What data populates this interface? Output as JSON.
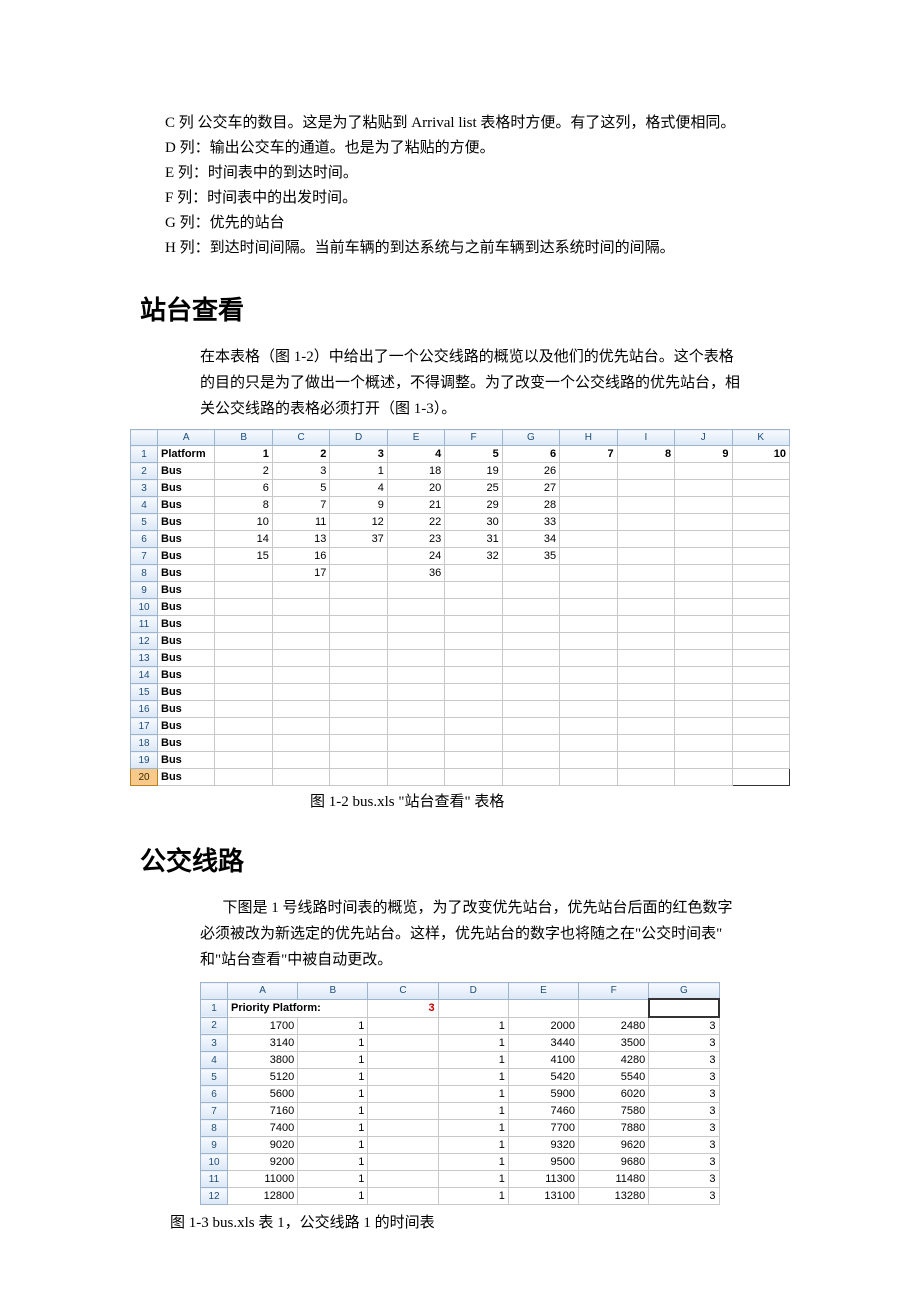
{
  "columns_desc": {
    "c": "C 列  公交车的数目。这是为了粘贴到 Arrival list 表格时方便。有了这列，格式便相同。",
    "d": "D 列：输出公交车的通道。也是为了粘贴的方便。",
    "e": "E 列：时间表中的到达时间。",
    "f": "F 列：时间表中的出发时间。",
    "g": "G 列：优先的站台",
    "h": "H 列：到达时间间隔。当前车辆的到达系统与之前车辆到达系统时间的间隔。"
  },
  "section1": {
    "title": "站台查看",
    "para1": "在本表格（图 1-2）中给出了一个公交线路的概览以及他们的优先站台。这个表格",
    "para2": "的目的只是为了做出一个概述，不得调整。为了改变一个公交线路的优先站台，相",
    "para3": "关公交线路的表格必须打开（图 1-3）。"
  },
  "table1": {
    "cols": [
      "A",
      "B",
      "C",
      "D",
      "E",
      "F",
      "G",
      "H",
      "I",
      "J",
      "K"
    ],
    "rows": [
      {
        "n": 1,
        "bold": true,
        "cells": [
          "Platform",
          "1",
          "2",
          "3",
          "4",
          "5",
          "6",
          "7",
          "8",
          "9",
          "10"
        ]
      },
      {
        "n": 2,
        "cells": [
          "Bus",
          "2",
          "3",
          "1",
          "18",
          "19",
          "26",
          "",
          "",
          "",
          ""
        ]
      },
      {
        "n": 3,
        "cells": [
          "Bus",
          "6",
          "5",
          "4",
          "20",
          "25",
          "27",
          "",
          "",
          "",
          ""
        ]
      },
      {
        "n": 4,
        "cells": [
          "Bus",
          "8",
          "7",
          "9",
          "21",
          "29",
          "28",
          "",
          "",
          "",
          ""
        ]
      },
      {
        "n": 5,
        "cells": [
          "Bus",
          "10",
          "11",
          "12",
          "22",
          "30",
          "33",
          "",
          "",
          "",
          ""
        ]
      },
      {
        "n": 6,
        "cells": [
          "Bus",
          "14",
          "13",
          "37",
          "23",
          "31",
          "34",
          "",
          "",
          "",
          ""
        ]
      },
      {
        "n": 7,
        "cells": [
          "Bus",
          "15",
          "16",
          "",
          "24",
          "32",
          "35",
          "",
          "",
          "",
          ""
        ]
      },
      {
        "n": 8,
        "cells": [
          "Bus",
          "",
          "17",
          "",
          "36",
          "",
          "",
          "",
          "",
          "",
          ""
        ]
      },
      {
        "n": 9,
        "cells": [
          "Bus",
          "",
          "",
          "",
          "",
          "",
          "",
          "",
          "",
          "",
          ""
        ]
      },
      {
        "n": 10,
        "cells": [
          "Bus",
          "",
          "",
          "",
          "",
          "",
          "",
          "",
          "",
          "",
          ""
        ]
      },
      {
        "n": 11,
        "cells": [
          "Bus",
          "",
          "",
          "",
          "",
          "",
          "",
          "",
          "",
          "",
          ""
        ]
      },
      {
        "n": 12,
        "cells": [
          "Bus",
          "",
          "",
          "",
          "",
          "",
          "",
          "",
          "",
          "",
          ""
        ]
      },
      {
        "n": 13,
        "cells": [
          "Bus",
          "",
          "",
          "",
          "",
          "",
          "",
          "",
          "",
          "",
          ""
        ]
      },
      {
        "n": 14,
        "cells": [
          "Bus",
          "",
          "",
          "",
          "",
          "",
          "",
          "",
          "",
          "",
          ""
        ]
      },
      {
        "n": 15,
        "cells": [
          "Bus",
          "",
          "",
          "",
          "",
          "",
          "",
          "",
          "",
          "",
          ""
        ]
      },
      {
        "n": 16,
        "cells": [
          "Bus",
          "",
          "",
          "",
          "",
          "",
          "",
          "",
          "",
          "",
          ""
        ]
      },
      {
        "n": 17,
        "cells": [
          "Bus",
          "",
          "",
          "",
          "",
          "",
          "",
          "",
          "",
          "",
          ""
        ]
      },
      {
        "n": 18,
        "cells": [
          "Bus",
          "",
          "",
          "",
          "",
          "",
          "",
          "",
          "",
          "",
          ""
        ]
      },
      {
        "n": 19,
        "cells": [
          "Bus",
          "",
          "",
          "",
          "",
          "",
          "",
          "",
          "",
          "",
          ""
        ]
      },
      {
        "n": 20,
        "cells": [
          "Bus",
          "",
          "",
          "",
          "",
          "",
          "",
          "",
          "",
          "",
          ""
        ]
      }
    ],
    "caption": "图 1-2 bus.xls  \"站台查看\" 表格"
  },
  "section2": {
    "title": "公交线路",
    "para1": "下图是 1 号线路时间表的概览，为了改变优先站台，优先站台后面的红色数字",
    "para2": "必须被改为新选定的优先站台。这样，优先站台的数字也将随之在\"公交时间表\"",
    "para3": "和\"站台查看\"中被自动更改。"
  },
  "table2": {
    "cols": [
      "A",
      "B",
      "C",
      "D",
      "E",
      "F",
      "G"
    ],
    "header_row": {
      "n": 1,
      "label": "Priority Platform:",
      "value": "3"
    },
    "rows": [
      {
        "n": 2,
        "cells": [
          "1700",
          "1",
          "",
          "1",
          "2000",
          "2480",
          "3"
        ]
      },
      {
        "n": 3,
        "cells": [
          "3140",
          "1",
          "",
          "1",
          "3440",
          "3500",
          "3"
        ]
      },
      {
        "n": 4,
        "cells": [
          "3800",
          "1",
          "",
          "1",
          "4100",
          "4280",
          "3"
        ]
      },
      {
        "n": 5,
        "cells": [
          "5120",
          "1",
          "",
          "1",
          "5420",
          "5540",
          "3"
        ]
      },
      {
        "n": 6,
        "cells": [
          "5600",
          "1",
          "",
          "1",
          "5900",
          "6020",
          "3"
        ]
      },
      {
        "n": 7,
        "cells": [
          "7160",
          "1",
          "",
          "1",
          "7460",
          "7580",
          "3"
        ]
      },
      {
        "n": 8,
        "cells": [
          "7400",
          "1",
          "",
          "1",
          "7700",
          "7880",
          "3"
        ]
      },
      {
        "n": 9,
        "cells": [
          "9020",
          "1",
          "",
          "1",
          "9320",
          "9620",
          "3"
        ]
      },
      {
        "n": 10,
        "cells": [
          "9200",
          "1",
          "",
          "1",
          "9500",
          "9680",
          "3"
        ]
      },
      {
        "n": 11,
        "cells": [
          "11000",
          "1",
          "",
          "1",
          "11300",
          "11480",
          "3"
        ]
      },
      {
        "n": 12,
        "cells": [
          "12800",
          "1",
          "",
          "1",
          "13100",
          "13280",
          "3"
        ]
      }
    ],
    "caption": "图 1-3 bus.xls  表 1，公交线路 1 的时间表"
  }
}
